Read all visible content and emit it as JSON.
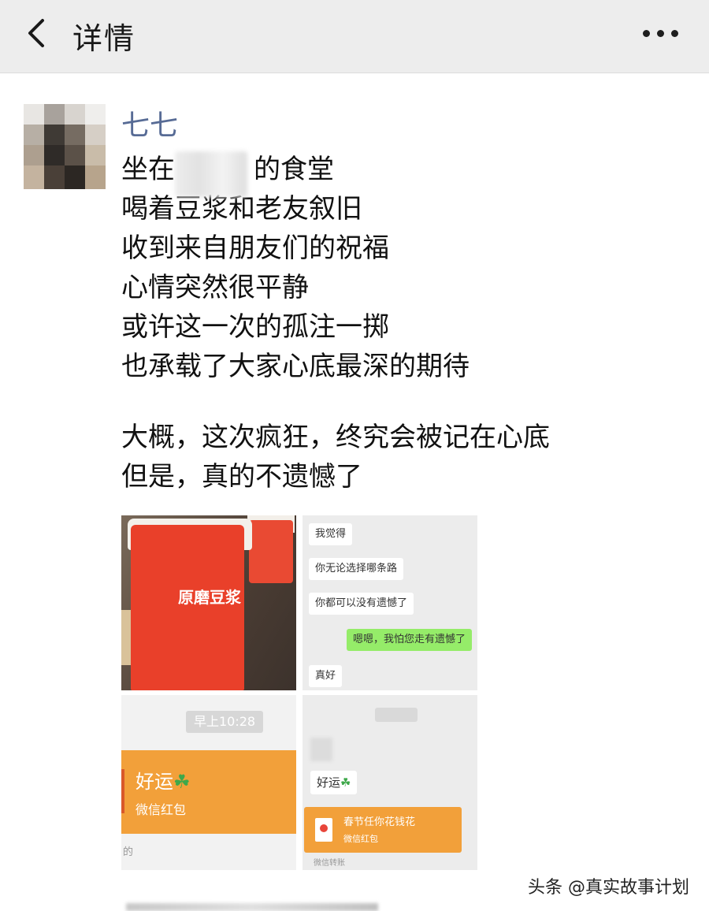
{
  "header": {
    "back_icon": "chevron-left-icon",
    "title": "详情",
    "more_icon": "more-horizontal-icon"
  },
  "post": {
    "author": "七七",
    "lines": [
      "坐在",
      "的食堂",
      "喝着豆浆和老友叙旧",
      "收到来自朋友们的祝福",
      "心情突然很平静",
      "或许这一次的孤注一掷",
      "也承载了大家心底最深的期待",
      "大概，这次疯狂，终究会被记在心底",
      "但是，真的不遗憾了"
    ]
  },
  "images": {
    "cup_text": "原磨豆浆",
    "chat": {
      "m1": "我觉得",
      "m2": "你无论选择哪条路",
      "m3": "你都可以没有遗憾了",
      "m4": "嗯嗯，我怕您走有遗憾了",
      "m5": "真好"
    },
    "card3": {
      "time": "早上10:28",
      "good_luck": "好运",
      "red_packet": "微信红包",
      "note": "的"
    },
    "card4": {
      "good_luck": "好运",
      "rp_title": "春节任你花钱花",
      "rp_sub": "微信红包",
      "tag": "微信转账"
    }
  },
  "watermark": "头条 @真实故事计划"
}
